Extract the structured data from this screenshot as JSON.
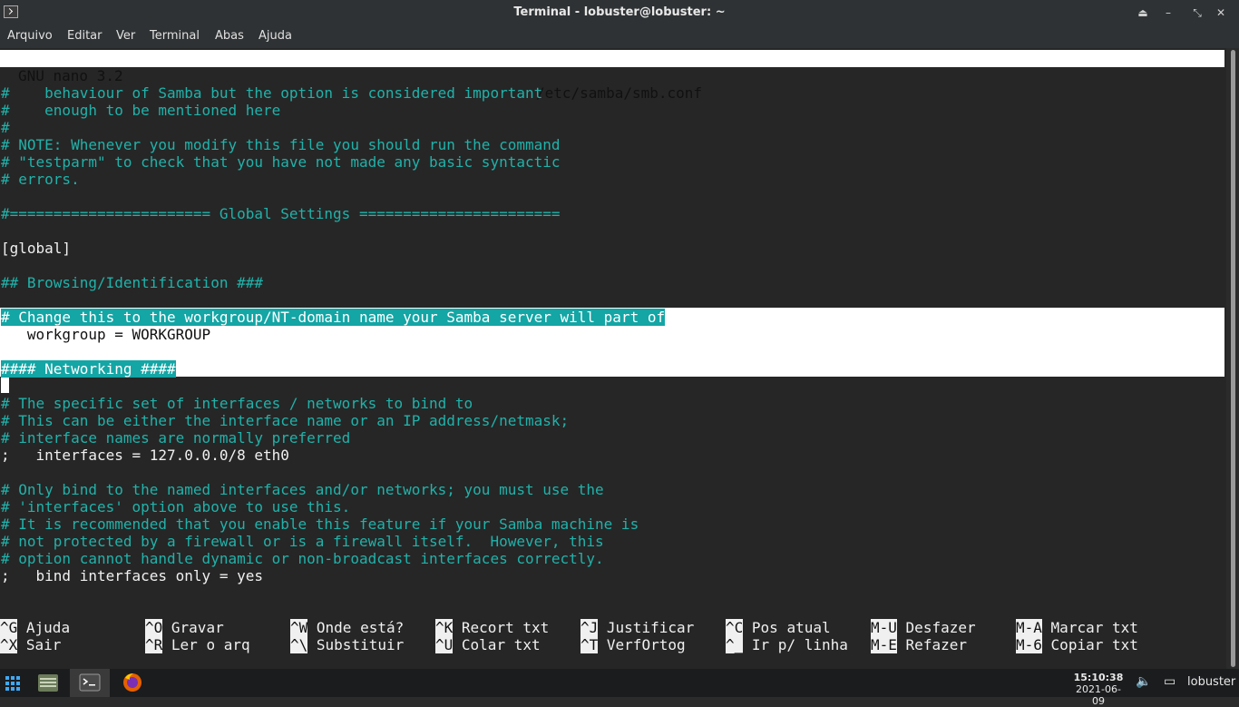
{
  "window": {
    "title": "Terminal - lobuster@lobuster: ~",
    "controls": [
      "up-icon",
      "minimize-icon",
      "restore-icon",
      "close-icon"
    ]
  },
  "menu": [
    "Arquivo",
    "Editar",
    "Ver",
    "Terminal",
    "Abas",
    "Ajuda"
  ],
  "nano": {
    "version": "GNU nano 3.2",
    "file": "/etc/samba/smb.conf"
  },
  "content": {
    "lines": [
      "#    behaviour of Samba but the option is considered important",
      "#    enough to be mentioned here",
      "#",
      "# NOTE: Whenever you modify this file you should run the command",
      "# \"testparm\" to check that you have not made any basic syntactic",
      "# errors.",
      "",
      "#======================= Global Settings =======================",
      "",
      "[global]",
      "",
      "## Browsing/Identification ###",
      "",
      "# Change this to the workgroup/NT-domain name your Samba server will part of",
      "   workgroup = WORKGROUP",
      "",
      "#### Networking ####",
      "",
      "# The specific set of interfaces / networks to bind to",
      "# This can be either the interface name or an IP address/netmask;",
      "# interface names are normally preferred",
      ";   interfaces = 127.0.0.0/8 eth0",
      "",
      "# Only bind to the named interfaces and/or networks; you must use the",
      "# 'interfaces' option above to use this.",
      "# It is recommended that you enable this feature if your Samba machine is",
      "# not protected by a firewall or is a firewall itself.  However, this",
      "# option cannot handle dynamic or non-broadcast interfaces correctly.",
      ";   bind interfaces only = yes"
    ]
  },
  "shortcuts": [
    {
      "key": "^G",
      "label": "Ajuda"
    },
    {
      "key": "^O",
      "label": "Gravar"
    },
    {
      "key": "^W",
      "label": "Onde está?"
    },
    {
      "key": "^K",
      "label": "Recort txt"
    },
    {
      "key": "^J",
      "label": "Justificar"
    },
    {
      "key": "^C",
      "label": "Pos atual"
    },
    {
      "key": "M-U",
      "label": "Desfazer"
    },
    {
      "key": "M-A",
      "label": "Marcar txt"
    },
    {
      "key": "^X",
      "label": "Sair"
    },
    {
      "key": "^R",
      "label": "Ler o arq"
    },
    {
      "key": "^\\",
      "label": "Substituir"
    },
    {
      "key": "^U",
      "label": "Colar txt"
    },
    {
      "key": "^T",
      "label": "VerfOrtog"
    },
    {
      "key": "^_",
      "label": "Ir p/ linha"
    },
    {
      "key": "M-E",
      "label": "Refazer"
    },
    {
      "key": "M-6",
      "label": "Copiar txt"
    }
  ],
  "taskbar": {
    "apps": [
      "apps-grid-icon",
      "file-manager-icon",
      "terminal-icon",
      "firefox-icon"
    ],
    "time": "15:10:38",
    "date": "2021-06-09",
    "user": "lobuster"
  },
  "colors": {
    "comment": "#20b2aa",
    "selection_bg": "#ffffff",
    "highlight_bg": "#14a5a5",
    "terminal_bg": "#262626"
  }
}
